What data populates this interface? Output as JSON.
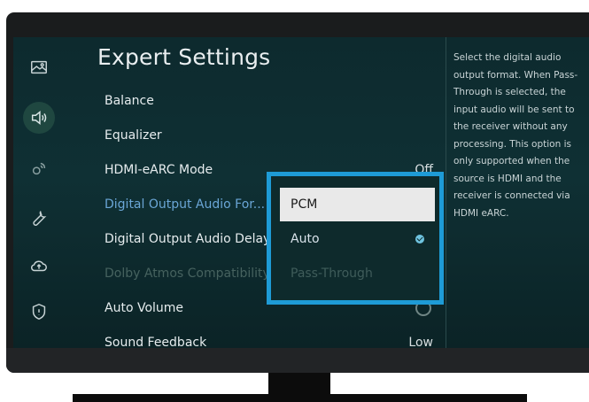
{
  "page": {
    "title": "Expert Settings"
  },
  "sidebar": {
    "items": [
      {
        "icon": "picture-icon",
        "active": false
      },
      {
        "icon": "sound-icon",
        "active": true
      },
      {
        "icon": "broadcast-icon",
        "active": false
      },
      {
        "icon": "wrench-icon",
        "active": false
      },
      {
        "icon": "cloud-update-icon",
        "active": false
      },
      {
        "icon": "shield-icon",
        "active": false
      }
    ]
  },
  "settings": {
    "items": [
      {
        "label": "Balance",
        "value": ""
      },
      {
        "label": "Equalizer",
        "value": ""
      },
      {
        "label": "HDMI-eARC Mode",
        "value": "Off"
      },
      {
        "label": "Digital Output Audio For...",
        "value": "",
        "state": "selected"
      },
      {
        "label": "Digital Output Audio Delay",
        "value": ""
      },
      {
        "label": "Dolby Atmos Compatibility",
        "value": "",
        "state": "disabled"
      },
      {
        "label": "Auto Volume",
        "value": "",
        "control": "toggle"
      },
      {
        "label": "Sound Feedback",
        "value": "Low"
      }
    ]
  },
  "dropdown": {
    "options": [
      {
        "label": "PCM",
        "state": "focused"
      },
      {
        "label": "Auto",
        "state": "checked"
      },
      {
        "label": "Pass-Through",
        "state": "disabled"
      }
    ]
  },
  "description": {
    "text": "Select the digital audio output format. When Pass-Through is selected, the input audio will be sent to the receiver without any processing. This option is only supported when the source is HDMI and the receiver is connected via HDMI eARC."
  },
  "colors": {
    "accent_border": "#1e9bd6",
    "selected_text": "#6aa6d6",
    "screen_bg": "#0f3034"
  }
}
